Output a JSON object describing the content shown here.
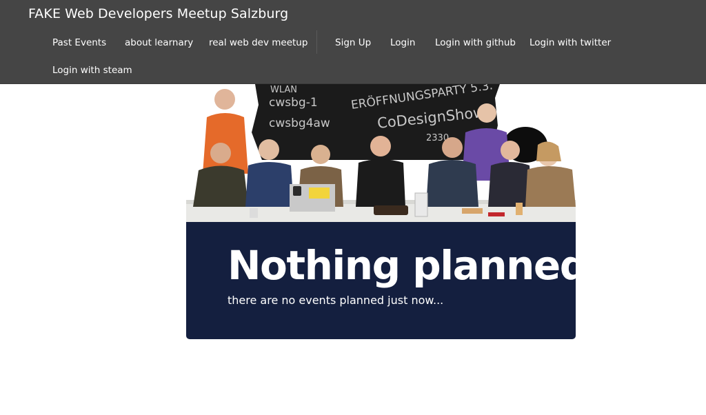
{
  "navbar": {
    "brand": "FAKE Web Developers Meetup Salzburg",
    "links_left": [
      "Past Events",
      "about learnary",
      "real web dev meetup"
    ],
    "links_right": [
      "Sign Up",
      "Login",
      "Login with github",
      "Login with twitter"
    ],
    "links_second_row": [
      "Login with steam"
    ]
  },
  "hero": {
    "photo_alt": "group photo of meetup attendees at a table in front of a chalkboard",
    "chalkboard_text": [
      "WLAN",
      "cwsbg-1",
      "cwsbg4aw",
      "ERÖFFNUNGSPARTY 5.3.",
      "CoDesignShow",
      "2330"
    ]
  },
  "jumbotron": {
    "title": "Nothing planned",
    "subtitle": "there are no events planned just now..."
  },
  "colors": {
    "navbar_bg": "#454545",
    "jumbotron_bg": "#141f3f",
    "text_light": "#ffffff"
  }
}
